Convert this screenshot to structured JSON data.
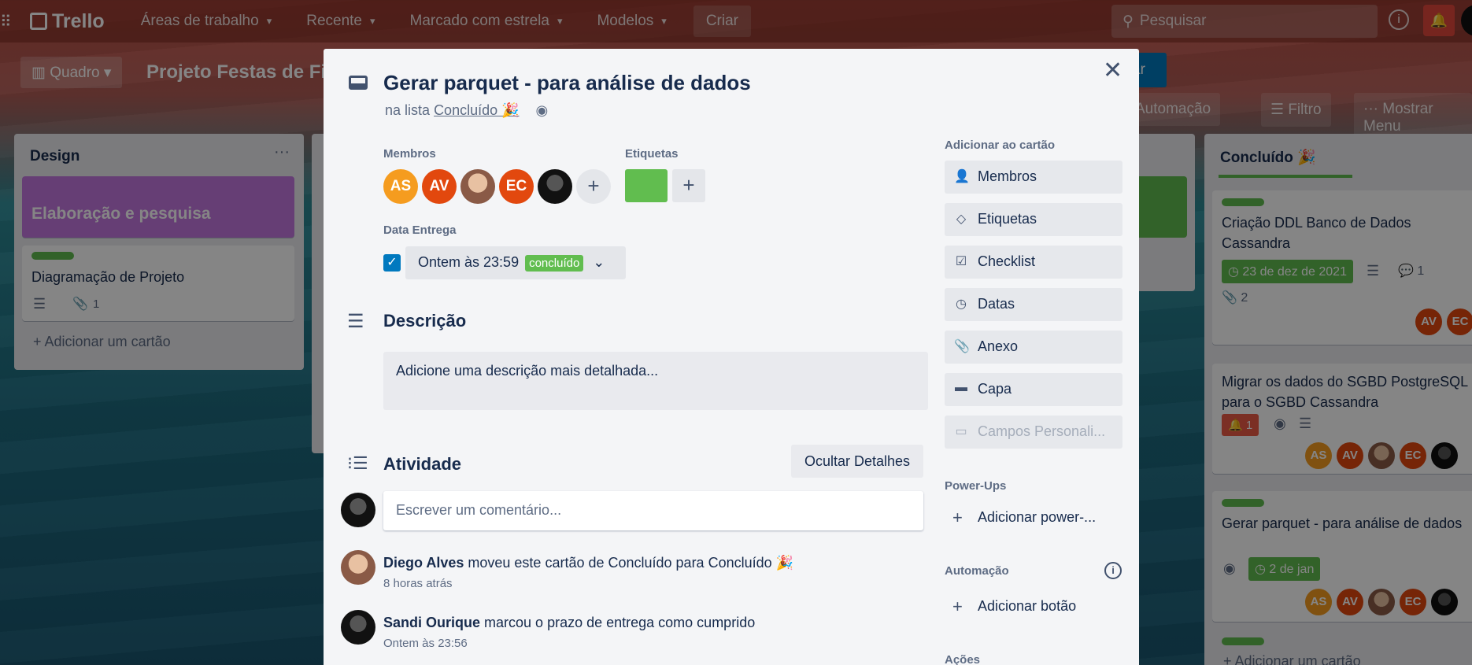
{
  "topbar": {
    "logo": "Trello",
    "nav": [
      "Áreas de trabalho",
      "Recente",
      "Marcado com estrela",
      "Modelos"
    ],
    "create": "Criar",
    "search_placeholder": "Pesquisar"
  },
  "board": {
    "view": "Quadro",
    "title": "Projeto Festas de Fi",
    "right_buttons": [
      "Automação",
      "Filtro",
      "Mostrar Menu"
    ],
    "share_fragment": "ar"
  },
  "lists": {
    "design": {
      "title": "Design",
      "cards": [
        {
          "title": "Elaboração e pesquisa"
        },
        {
          "title": "Diagramação de Projeto",
          "attachments": "1"
        }
      ],
      "add_card": "Adicionar um cartão"
    },
    "concluido": {
      "title": "Concluído 🎉",
      "cards": [
        {
          "title": "Criação DDL Banco de Dados Cassandra",
          "due": "23 de dez de 2021",
          "comments": "1",
          "attachments": "2",
          "members": [
            "AV",
            "EC"
          ]
        },
        {
          "title": "Migrar os dados do SGBD PostgreSQL para o SGBD Cassandra",
          "notifications": "1",
          "members": [
            "AS",
            "AV",
            "",
            "EC",
            ""
          ]
        },
        {
          "title": "Gerar parquet - para análise de dados",
          "due": "2 de jan",
          "members": [
            "AS",
            "AV",
            "",
            "EC",
            ""
          ]
        }
      ],
      "add_card": "Adicionar um cartão"
    }
  },
  "modal": {
    "title": "Gerar parquet - para análise de dados",
    "in_list_prefix": "na lista",
    "list_name": "Concluído 🎉",
    "members_label": "Membros",
    "members": [
      "AS",
      "AV",
      "",
      "EC",
      ""
    ],
    "labels_label": "Etiquetas",
    "due_label": "Data Entrega",
    "due_value": "Ontem às 23:59",
    "due_badge": "concluído",
    "description_title": "Descrição",
    "description_placeholder": "Adicione uma descrição mais detalhada...",
    "activity_title": "Atividade",
    "hide_details": "Ocultar Detalhes",
    "comment_placeholder": "Escrever um comentário...",
    "activities": [
      {
        "user": "Diego Alves",
        "action": "moveu este cartão de Concluído para Concluído 🎉",
        "time": "8 horas atrás"
      },
      {
        "user": "Sandi Ourique",
        "action": "marcou o prazo de entrega como cumprido",
        "time": "Ontem às 23:56"
      }
    ],
    "sidebar": {
      "add_to_card": "Adicionar ao cartão",
      "buttons": [
        "Membros",
        "Etiquetas",
        "Checklist",
        "Datas",
        "Anexo",
        "Capa",
        "Campos Personali..."
      ],
      "powerups_label": "Power-Ups",
      "add_powerup": "Adicionar power-...",
      "automation_label": "Automação",
      "add_button": "Adicionar botão",
      "actions_label": "Ações"
    }
  },
  "colors": {
    "green_label": "#61bd4f",
    "blue": "#0079bf",
    "purple_card": "#c377e0",
    "bell_red": "#e2483d"
  }
}
